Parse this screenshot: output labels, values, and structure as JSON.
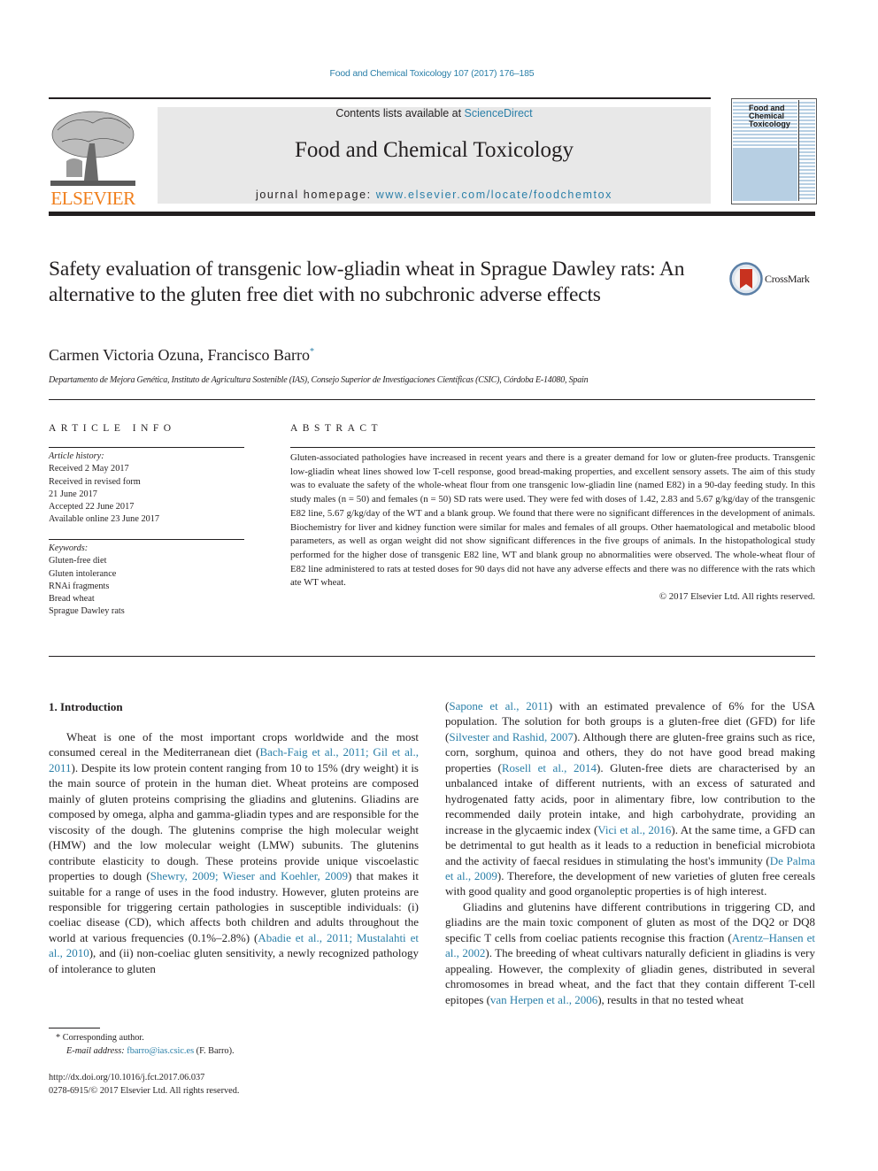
{
  "header": {
    "journal_reference": "Food and Chemical Toxicology 107 (2017) 176–185",
    "contents_prefix": "Contents lists available at ",
    "contents_link": "ScienceDirect",
    "journal_name": "Food and Chemical Toxicology",
    "homepage_prefix": "journal homepage: ",
    "homepage_link": "www.elsevier.com/locate/foodchemtox",
    "publisher_logo_text": "ELSEVIER",
    "cover_title_lines": [
      "Food and",
      "Chemical",
      "Toxicology"
    ],
    "crossmark_label": "CrossMark"
  },
  "article": {
    "title": "Safety evaluation of transgenic low-gliadin wheat in Sprague Dawley rats: An alternative to the gluten free diet with no subchronic adverse effects",
    "authors": "Carmen Victoria Ozuna, Francisco Barro",
    "author_marker": "*",
    "affiliation": "Departamento de Mejora Genética, Instituto de Agricultura Sostenible (IAS), Consejo Superior de Investigaciones Científicas (CSIC), Córdoba E-14080, Spain"
  },
  "article_info": {
    "heading": "ARTICLE INFO",
    "history_label": "Article history:",
    "history": [
      "Received 2 May 2017",
      "Received in revised form",
      "21 June 2017",
      "Accepted 22 June 2017",
      "Available online 23 June 2017"
    ],
    "keywords_label": "Keywords:",
    "keywords": [
      "Gluten-free diet",
      "Gluten intolerance",
      "RNAi fragments",
      "Bread wheat",
      "Sprague Dawley rats"
    ]
  },
  "abstract": {
    "heading": "ABSTRACT",
    "text": "Gluten-associated pathologies have increased in recent years and there is a greater demand for low or gluten-free products. Transgenic low-gliadin wheat lines showed low T-cell response, good bread-making properties, and excellent sensory assets. The aim of this study was to evaluate the safety of the whole-wheat flour from one transgenic low-gliadin line (named E82) in a 90-day feeding study. In this study males (n = 50) and females (n = 50) SD rats were used. They were fed with doses of 1.42, 2.83 and 5.67 g/kg/day of the transgenic E82 line, 5.67 g/kg/day of the WT and a blank group. We found that there were no significant differences in the development of animals. Biochemistry for liver and kidney function were similar for males and females of all groups. Other haematological and metabolic blood parameters, as well as organ weight did not show significant differences in the five groups of animals. In the histopathological study performed for the higher dose of transgenic E82 line, WT and blank group no abnormalities were observed. The whole-wheat flour of E82 line administered to rats at tested doses for 90 days did not have any adverse effects and there was no difference with the rats which ate WT wheat.",
    "copyright": "© 2017 Elsevier Ltd. All rights reserved."
  },
  "body": {
    "section_heading": "1.  Introduction",
    "left_column": [
      {
        "t": "Wheat is one of the most important crops worldwide and the most consumed cereal in the Mediterranean diet ("
      },
      {
        "link": "Bach-Faig et al., 2011; Gil et al., 2011"
      },
      {
        "t": "). Despite its low protein content ranging from 10 to 15% (dry weight) it is the main source of protein in the human diet. Wheat proteins are composed mainly of gluten proteins comprising the gliadins and glutenins. Gliadins are composed by omega, alpha and gamma-gliadin types and are responsible for the viscosity of the dough. The glutenins comprise the high molecular weight (HMW) and the low molecular weight (LMW) subunits. The glutenins contribute elasticity to dough. These proteins provide unique viscoelastic properties to dough ("
      },
      {
        "link": "Shewry, 2009; Wieser and Koehler, 2009"
      },
      {
        "t": ") that makes it suitable for a range of uses in the food industry. However, gluten proteins are responsible for triggering certain pathologies in susceptible individuals: (i) coeliac disease (CD), which affects both children and adults throughout the world at various frequencies (0.1%–2.8%) ("
      },
      {
        "link": "Abadie et al., 2011; Mustalahti et al., 2010"
      },
      {
        "t": "), and (ii) non-coeliac gluten sensitivity, a newly recognized pathology of intolerance to gluten"
      }
    ],
    "right_column_p1": [
      {
        "t": "("
      },
      {
        "link": "Sapone et al., 2011"
      },
      {
        "t": ") with an estimated prevalence of 6% for the USA population. The solution for both groups is a gluten-free diet (GFD) for life ("
      },
      {
        "link": "Silvester and Rashid, 2007"
      },
      {
        "t": "). Although there are gluten-free grains such as rice, corn, sorghum, quinoa and others, they do not have good bread making properties ("
      },
      {
        "link": "Rosell et al., 2014"
      },
      {
        "t": "). Gluten-free diets are characterised by an unbalanced intake of different nutrients, with an excess of saturated and hydrogenated fatty acids, poor in alimentary fibre, low contribution to the recommended daily protein intake, and high carbohydrate, providing an increase in the glycaemic index ("
      },
      {
        "link": "Vici et al., 2016"
      },
      {
        "t": "). At the same time, a GFD can be detrimental to gut health as it leads to a reduction in beneficial microbiota and the activity of faecal residues in stimulating the host's immunity ("
      },
      {
        "link": "De Palma et al., 2009"
      },
      {
        "t": "). Therefore, the development of new varieties of gluten free cereals with good quality and good organoleptic properties is of high interest."
      }
    ],
    "right_column_p2": [
      {
        "t": "Gliadins and glutenins have different contributions in triggering CD, and gliadins are the main toxic component of gluten as most of the DQ2 or DQ8 specific T cells from coeliac patients recognise this fraction ("
      },
      {
        "link": "Arentz–Hansen et al., 2002"
      },
      {
        "t": "). The breeding of wheat cultivars naturally deficient in gliadins is very appealing. However, the complexity of gliadin genes, distributed in several chromosomes in bread wheat, and the fact that they contain different T-cell epitopes ("
      },
      {
        "link": "van Herpen et al., 2006"
      },
      {
        "t": "), results in that no tested wheat"
      }
    ]
  },
  "footnotes": {
    "marker": "*",
    "corresponding": "Corresponding author.",
    "email_label": "E-mail address:",
    "email": "fbarro@ias.csic.es",
    "email_suffix": " (F. Barro).",
    "doi": "http://dx.doi.org/10.1016/j.fct.2017.06.037",
    "issn_line": "0278-6915/© 2017 Elsevier Ltd. All rights reserved."
  }
}
